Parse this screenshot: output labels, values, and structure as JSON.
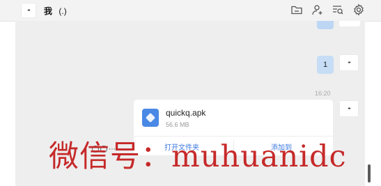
{
  "header": {
    "avatar_text": "••",
    "title": "我",
    "title_suffix": "(.)",
    "icons": [
      "folder-icon",
      "add-user-icon",
      "search-history-icon",
      "gear-icon"
    ]
  },
  "messages": [
    {
      "type": "text",
      "text": "1",
      "avatar_text": "••"
    },
    {
      "type": "time",
      "text": "16:20"
    },
    {
      "type": "file",
      "name": "quickq.apk",
      "size": "56.6 MB",
      "actions": [
        "打开文件夹",
        "添加到"
      ],
      "avatar_text": "••"
    }
  ],
  "watermark": "微信号：muhuanidc",
  "colors": {
    "accent": "#3d7ae0",
    "bubble": "#c6ddf5",
    "chat_bg": "#eeeeee",
    "file_icon": "#4a88e6",
    "watermark": "#c41f1f"
  }
}
